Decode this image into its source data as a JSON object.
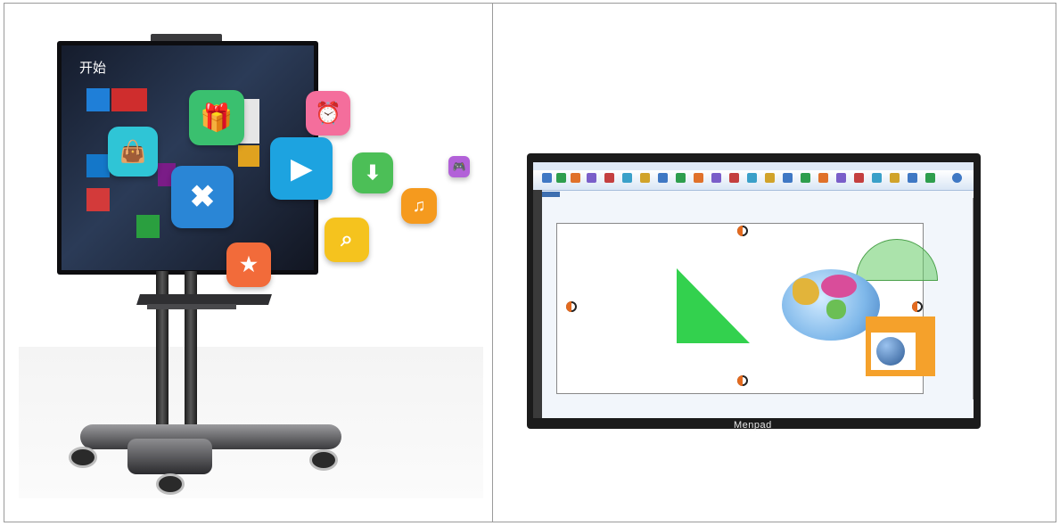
{
  "left_photo": {
    "screen_start_label": "开始",
    "tv_colors": {
      "bezel": "#0d0d10",
      "screen": "#2b3b57"
    },
    "tiles": [
      {
        "icon": "mail-tile",
        "color": "#1f7fd8"
      },
      {
        "icon": "weather-tile",
        "color": "#cf2d2d"
      },
      {
        "icon": "skype-tile",
        "color": "#1477c9"
      },
      {
        "icon": "store-tile",
        "color": "#2a9f3f"
      },
      {
        "icon": "settings-tile",
        "color": "#7a1c87"
      },
      {
        "icon": "photos-tile",
        "color": "#d33a3a"
      }
    ],
    "floating_icons": [
      {
        "name": "gift-icon",
        "color": "#3ac06f"
      },
      {
        "name": "alarm-clock-icon",
        "color": "#f46e9c"
      },
      {
        "name": "shopping-bag-icon",
        "color": "#2fc5d6"
      },
      {
        "name": "tools-icon",
        "color": "#2a86d6"
      },
      {
        "name": "video-player-icon",
        "color": "#1da3e0"
      },
      {
        "name": "download-icon",
        "color": "#4cbf57"
      },
      {
        "name": "music-note-icon",
        "color": "#f59a1e"
      },
      {
        "name": "search-icon",
        "color": "#f5c31e"
      },
      {
        "name": "bookmark-star-icon",
        "color": "#f26b3a"
      },
      {
        "name": "gamepad-icon",
        "color": "#b261d8"
      }
    ]
  },
  "right_photo": {
    "brand": "Menpad",
    "ribbon_colors": [
      "#3f78c4",
      "#2e9e4d",
      "#e0712a",
      "#7a5ec9",
      "#c43f3f",
      "#3aa0c9",
      "#d1a32a"
    ],
    "canvas_objects": [
      {
        "name": "ruler-triangle",
        "color": "#33d14e"
      },
      {
        "name": "world-globe",
        "color": "#7fb8ea"
      },
      {
        "name": "protractor",
        "color": "#66cc66"
      },
      {
        "name": "image-card",
        "color": "#f5a12b"
      }
    ]
  }
}
